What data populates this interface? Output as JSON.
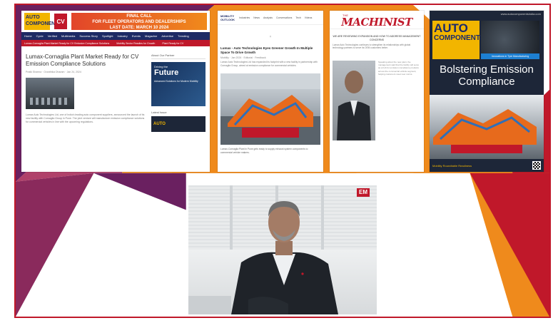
{
  "colors": {
    "orange": "#ef8a1c",
    "purple": "#6a2060",
    "red": "#c0182a",
    "navy": "#1d2a64",
    "gold": "#f2b500"
  },
  "clip1": {
    "logo": "AUTO COMPONENTS",
    "cv_badge": "CV",
    "ad_line1": "FINAL CALL",
    "ad_line2": "FOR FLEET OPERATORS AND DEALERSHIPS",
    "ad_line3": "LAST DATE: MARCH 10 2024",
    "nav": [
      "Home",
      "Cycle",
      "Verified",
      "Multimedia",
      "Success Story",
      "Spotlight",
      "Industry",
      "Events",
      "Magazine",
      "Advertise",
      "Trending"
    ],
    "ticker": [
      "Lumax-Cornaglia Plant Market Ready for CV Emission Compliance Solutions",
      "Mobility Sector Readies for Growth",
      "Plant Ready for CV"
    ],
    "title": "Lumax-Cornaglia Plant Market Ready for CV Emission Compliance Solutions",
    "meta": "Pratik Sharma · Ovanthika Dharam · Jan 24, 2024",
    "text": "Lumax Auto Technologies Ltd, one of India's leading auto component suppliers, announced the launch of its new facility with Cornaglia Group in Pune. The joint venture will manufacture emission compliance solutions for commercial vehicles in line with the upcoming regulations.",
    "side_title": "About Our Partner",
    "future_small": "Driving the",
    "future_big": "Future",
    "future_sub": "Advanced Solutions for Modern Mobility",
    "latest": "Latest Issue",
    "mini_logo": "AUTO"
  },
  "clip2": {
    "logo": "MOBILITY OUTLOOK",
    "nav": [
      "Industries",
      "News",
      "Analysis",
      "Conversations",
      "Tech",
      "Videos"
    ],
    "close": "×",
    "title": "Lumax - Auto Technologies Eyes Greener Growth In Multiple Space To Drive Growth",
    "meta": "Mobility · Jan 2024 · Editorial · Feedback",
    "text": "Lumax Auto Technologies Ltd has expanded its footprint with a new facility in partnership with Cornaglia Group, aimed at emission compliance for commercial vehicles.",
    "caption": "Lumax-Cornaglia Plant in Pune gets ready to supply exhaust system components to commercial vehicle makers."
  },
  "clip3": {
    "logo_the": "THE",
    "logo_name": "MACHINIST",
    "headline": "WE ARE REVIEWING EXPANSION AND HOW TO ADDRESS MANAGEMENT CONCERNS",
    "text": "Lumax Auto Technologies continues to strengthen its relationships with global technology partners to serve its OEM customers better.",
    "column": "Speaking about the new plant, the management said that the facility will serve as a hub for emission compliance products across the commercial vehicle segment, helping customers meet new norms."
  },
  "clip4": {
    "site": "www.autocomponentsindia.com",
    "logo_line1": "AUTO",
    "logo_line2": "COMPONENTS",
    "bluebar": "Innovations in Tyre Manufacturing",
    "headline_line1": "Bolstering Emission",
    "headline_line2": "Compliance",
    "footer": "Mobility Roundtable Readiness"
  },
  "photo": {
    "em_badge": "EM"
  }
}
